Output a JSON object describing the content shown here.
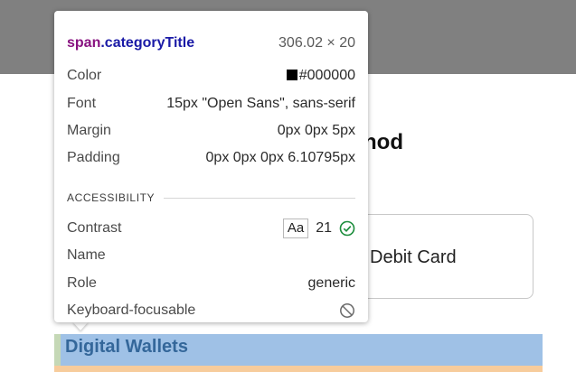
{
  "page": {
    "heading_fragment": "hod",
    "payment_option": "Debit Card",
    "category_title": "Digital Wallets"
  },
  "inspector": {
    "selector_tag": "span",
    "selector_class": ".categoryTitle",
    "size": "306.02 × 20",
    "color_label": "Color",
    "color_value": "#000000",
    "font_label": "Font",
    "font_value": "15px \"Open Sans\", sans-serif",
    "margin_label": "Margin",
    "margin_value": "0px 0px 5px",
    "padding_label": "Padding",
    "padding_value": "0px 0px 0px 6.10795px",
    "accessibility_title": "ACCESSIBILITY",
    "contrast_label": "Contrast",
    "contrast_aa": "Aa",
    "contrast_value": "21",
    "name_label": "Name",
    "role_label": "Role",
    "role_value": "generic",
    "focusable_label": "Keyboard-focusable"
  },
  "icons": {
    "contrast_pass": "check-circle-icon",
    "not_focusable": "no-entry-icon"
  },
  "colors": {
    "content_highlight": "#9fc1e6",
    "margin_highlight": "#f7cc9c",
    "padding_highlight": "#c5d8b6",
    "pass_green": "#1e8e3e"
  }
}
